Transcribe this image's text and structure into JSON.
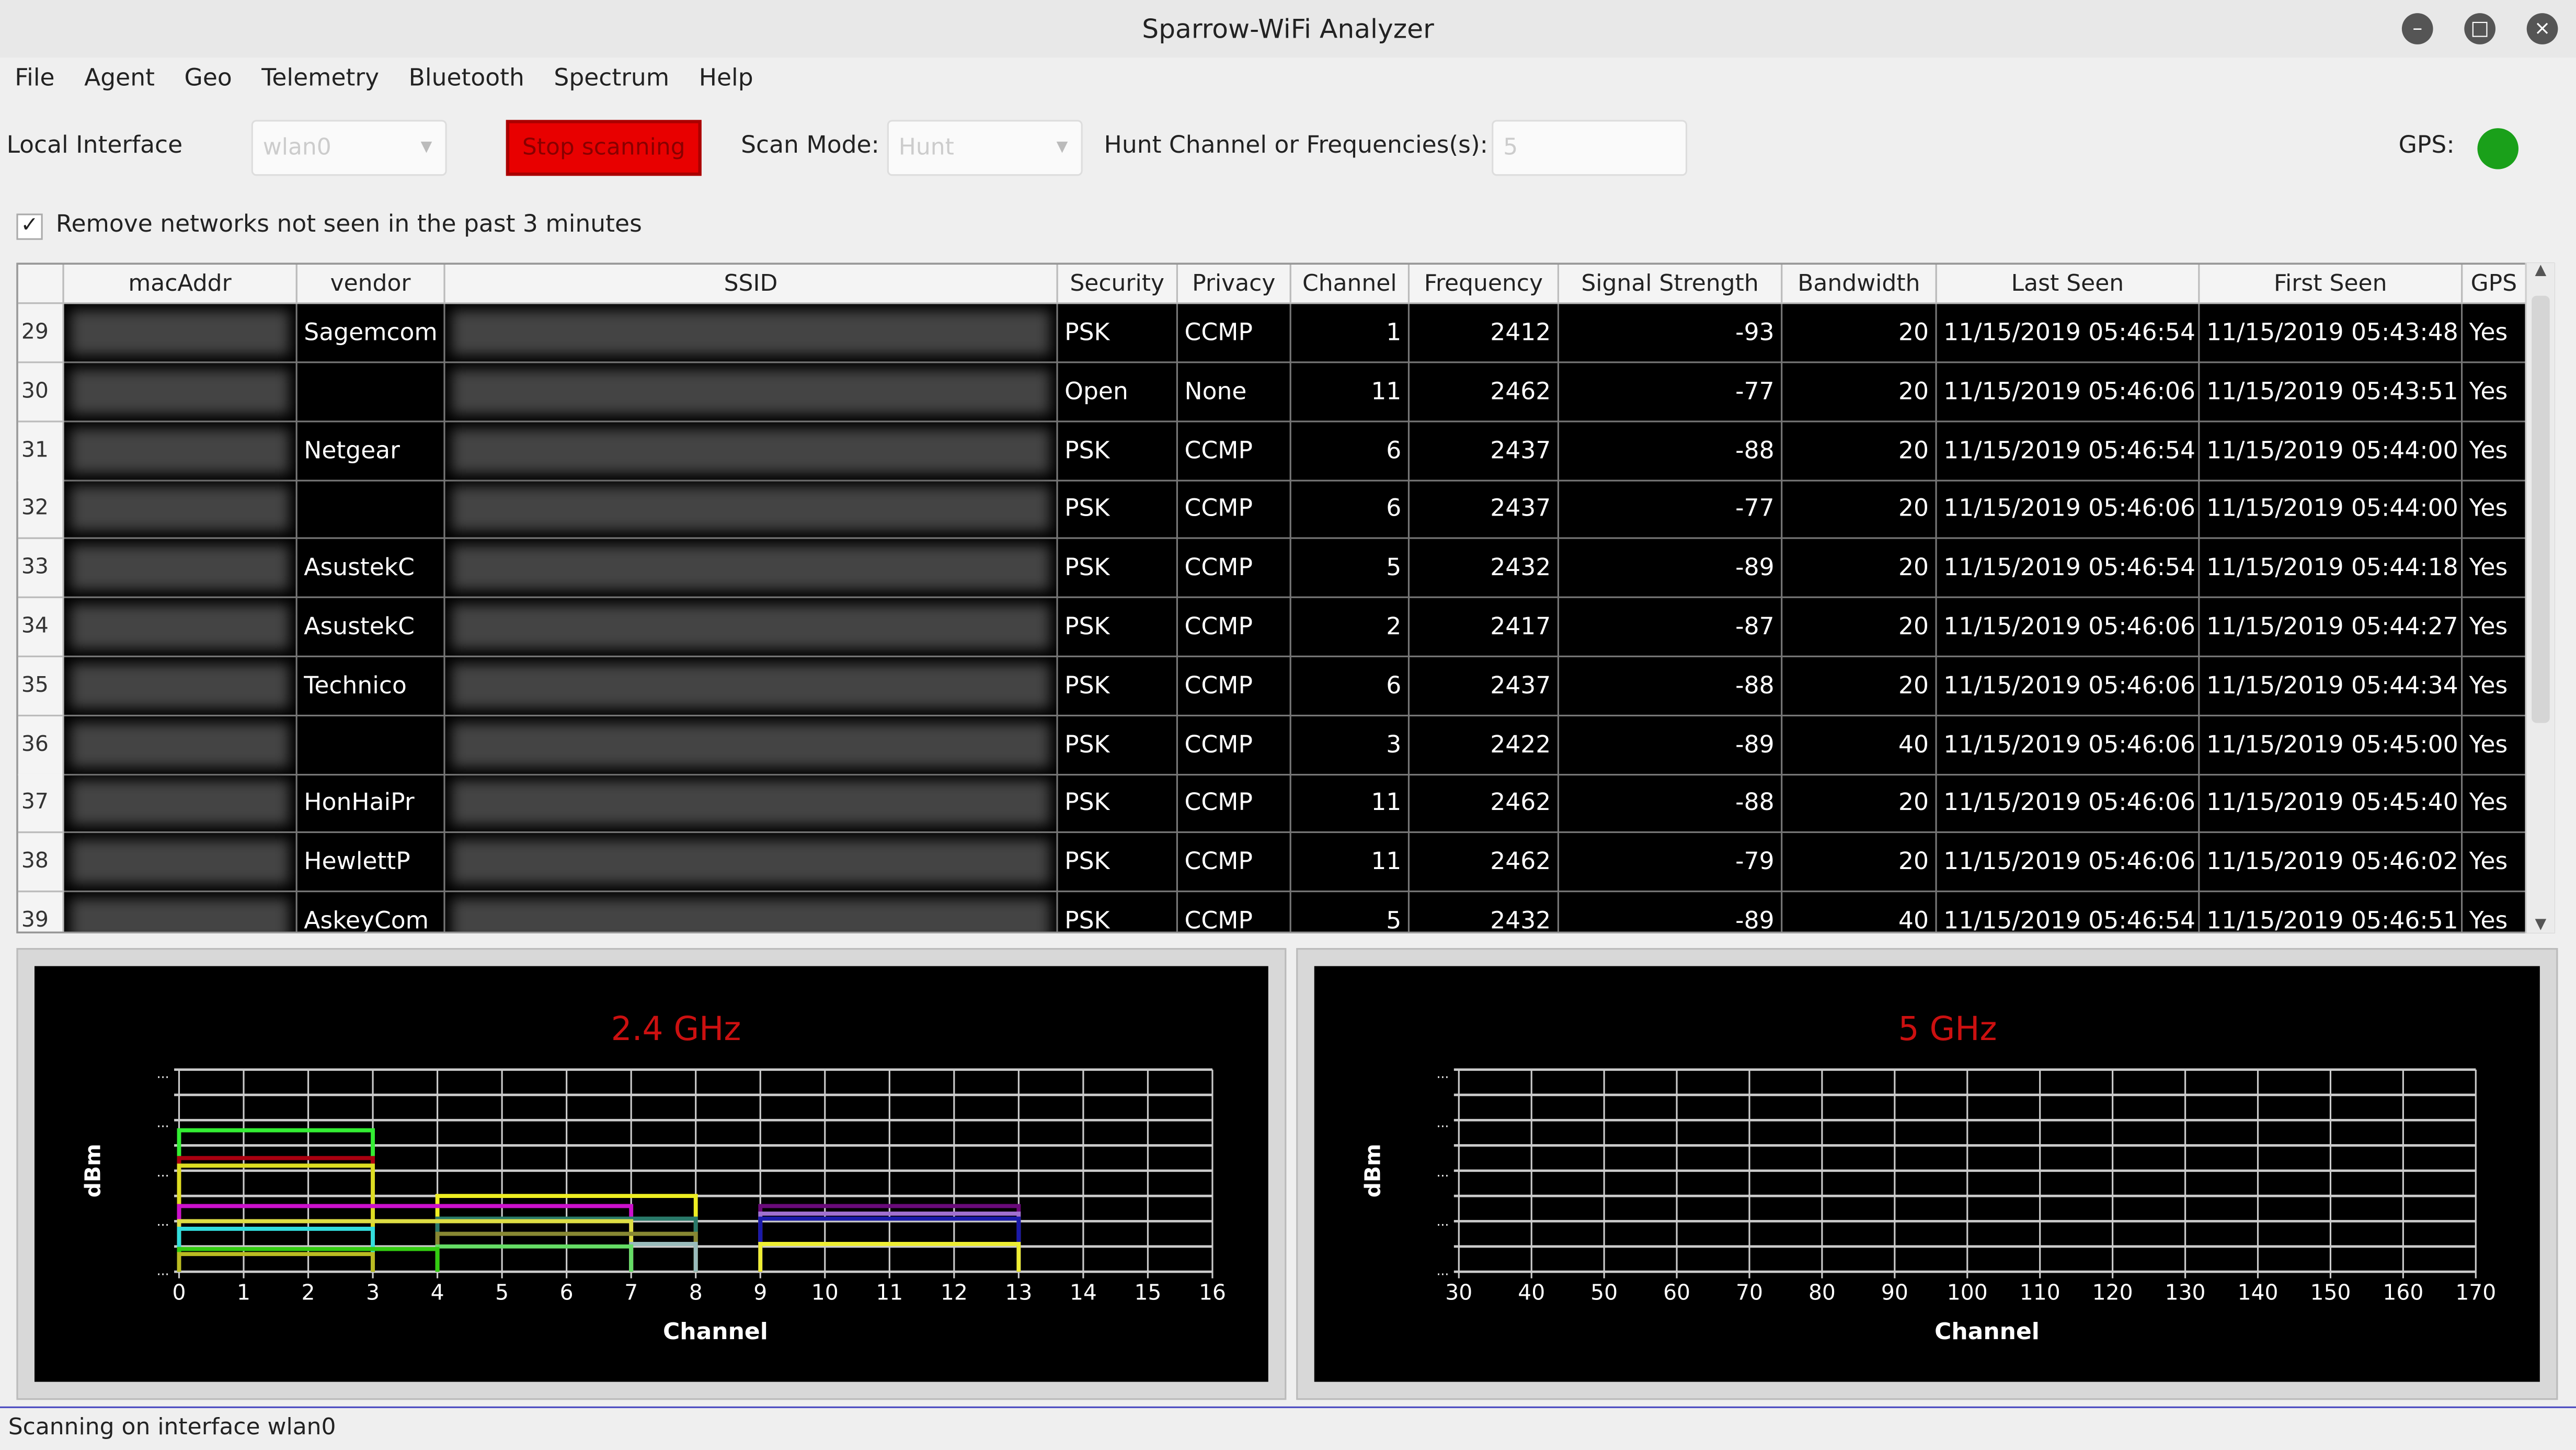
{
  "window": {
    "title": "Sparrow-WiFi Analyzer"
  },
  "menu": [
    "File",
    "Agent",
    "Geo",
    "Telemetry",
    "Bluetooth",
    "Spectrum",
    "Help"
  ],
  "toolbar": {
    "local_interface_label": "Local Interface",
    "interface_value": "wlan0",
    "stop_button": "Stop scanning",
    "scan_mode_label": "Scan Mode:",
    "scan_mode_value": "Hunt",
    "hunt_label": "Hunt Channel or Frequencies(s):",
    "hunt_value": "5",
    "gps_label": "GPS:",
    "gps_color": "#1aa01a"
  },
  "remove_old": {
    "checked": true,
    "label": "Remove networks not seen in the past 3 minutes"
  },
  "table": {
    "columns": [
      "macAddr",
      "vendor",
      "SSID",
      "Security",
      "Privacy",
      "Channel",
      "Frequency",
      "Signal Strength",
      "Bandwidth",
      "Last Seen",
      "First Seen",
      "GPS"
    ],
    "rows": [
      {
        "n": "29",
        "vendor": "Sagemcom",
        "security": "PSK",
        "privacy": "CCMP",
        "channel": "1",
        "frequency": "2412",
        "signal": "-93",
        "bandwidth": "20",
        "last": "11/15/2019 05:46:54",
        "first": "11/15/2019 05:43:48",
        "gps": "Yes"
      },
      {
        "n": "30",
        "vendor": "",
        "security": "Open",
        "privacy": "None",
        "channel": "11",
        "frequency": "2462",
        "signal": "-77",
        "bandwidth": "20",
        "last": "11/15/2019 05:46:06",
        "first": "11/15/2019 05:43:51",
        "gps": "Yes"
      },
      {
        "n": "31",
        "vendor": "Netgear",
        "security": "PSK",
        "privacy": "CCMP",
        "channel": "6",
        "frequency": "2437",
        "signal": "-88",
        "bandwidth": "20",
        "last": "11/15/2019 05:46:54",
        "first": "11/15/2019 05:44:00",
        "gps": "Yes"
      },
      {
        "n": "32",
        "vendor": "",
        "security": "PSK",
        "privacy": "CCMP",
        "channel": "6",
        "frequency": "2437",
        "signal": "-77",
        "bandwidth": "20",
        "last": "11/15/2019 05:46:06",
        "first": "11/15/2019 05:44:00",
        "gps": "Yes"
      },
      {
        "n": "33",
        "vendor": "AsustekC",
        "security": "PSK",
        "privacy": "CCMP",
        "channel": "5",
        "frequency": "2432",
        "signal": "-89",
        "bandwidth": "20",
        "last": "11/15/2019 05:46:54",
        "first": "11/15/2019 05:44:18",
        "gps": "Yes"
      },
      {
        "n": "34",
        "vendor": "AsustekC",
        "security": "PSK",
        "privacy": "CCMP",
        "channel": "2",
        "frequency": "2417",
        "signal": "-87",
        "bandwidth": "20",
        "last": "11/15/2019 05:46:06",
        "first": "11/15/2019 05:44:27",
        "gps": "Yes"
      },
      {
        "n": "35",
        "vendor": "Technico",
        "security": "PSK",
        "privacy": "CCMP",
        "channel": "6",
        "frequency": "2437",
        "signal": "-88",
        "bandwidth": "20",
        "last": "11/15/2019 05:46:06",
        "first": "11/15/2019 05:44:34",
        "gps": "Yes"
      },
      {
        "n": "36",
        "vendor": "",
        "security": "PSK",
        "privacy": "CCMP",
        "channel": "3",
        "frequency": "2422",
        "signal": "-89",
        "bandwidth": "40",
        "last": "11/15/2019 05:46:06",
        "first": "11/15/2019 05:45:00",
        "gps": "Yes"
      },
      {
        "n": "37",
        "vendor": "HonHaiPr",
        "security": "PSK",
        "privacy": "CCMP",
        "channel": "11",
        "frequency": "2462",
        "signal": "-88",
        "bandwidth": "20",
        "last": "11/15/2019 05:46:06",
        "first": "11/15/2019 05:45:40",
        "gps": "Yes"
      },
      {
        "n": "38",
        "vendor": "HewlettP",
        "security": "PSK",
        "privacy": "CCMP",
        "channel": "11",
        "frequency": "2462",
        "signal": "-79",
        "bandwidth": "20",
        "last": "11/15/2019 05:46:06",
        "first": "11/15/2019 05:46:02",
        "gps": "Yes"
      },
      {
        "n": "39",
        "vendor": "AskeyCom",
        "security": "PSK",
        "privacy": "CCMP",
        "channel": "5",
        "frequency": "2432",
        "signal": "-89",
        "bandwidth": "40",
        "last": "11/15/2019 05:46:54",
        "first": "11/15/2019 05:46:51",
        "gps": "Yes"
      }
    ]
  },
  "chart_data": [
    {
      "type": "line",
      "title": "2.4 GHz",
      "title_color": "#cc1010",
      "xlabel": "Channel",
      "ylabel": "dBm",
      "xlim": [
        0,
        16
      ],
      "xticks": [
        0,
        1,
        2,
        3,
        4,
        5,
        6,
        7,
        8,
        9,
        10,
        11,
        12,
        13,
        14,
        15,
        16
      ],
      "ylim": [
        -100,
        -20
      ],
      "y_tick_labels": "...",
      "grid": true,
      "series": [
        {
          "from": 0,
          "to": 3,
          "dbm": -44,
          "color": "#33ee33"
        },
        {
          "from": 0,
          "to": 3,
          "dbm": -55,
          "color": "#aa0010"
        },
        {
          "from": 0,
          "to": 3,
          "dbm": -58,
          "color": "#dddd22"
        },
        {
          "from": 4,
          "to": 8,
          "dbm": -70,
          "color": "#eeee22"
        },
        {
          "from": 0,
          "to": 7,
          "dbm": -74,
          "color": "#cc11cc"
        },
        {
          "from": 9,
          "to": 13,
          "dbm": -74,
          "color": "#6a0a7a"
        },
        {
          "from": 9,
          "to": 13,
          "dbm": -77,
          "color": "#a070d0"
        },
        {
          "from": 9,
          "to": 13,
          "dbm": -79,
          "color": "#1a1aaa"
        },
        {
          "from": 4,
          "to": 8,
          "dbm": -79,
          "color": "#2a7a6a"
        },
        {
          "from": 0,
          "to": 7,
          "dbm": -80,
          "color": "#dddd44"
        },
        {
          "from": 0,
          "to": 3,
          "dbm": -83,
          "color": "#33dddd"
        },
        {
          "from": 4,
          "to": 8,
          "dbm": -85,
          "color": "#888833"
        },
        {
          "from": 7,
          "to": 8,
          "dbm": -89,
          "color": "#99bbbb"
        },
        {
          "from": 4,
          "to": 7,
          "dbm": -90,
          "color": "#66dd66"
        },
        {
          "from": 9,
          "to": 13,
          "dbm": -89,
          "color": "#eeee33"
        },
        {
          "from": 0,
          "to": 4,
          "dbm": -91,
          "color": "#33cc11"
        },
        {
          "from": 0,
          "to": 3,
          "dbm": -93,
          "color": "#bbbb22"
        }
      ]
    },
    {
      "type": "line",
      "title": "5 GHz",
      "title_color": "#cc1010",
      "xlabel": "Channel",
      "ylabel": "dBm",
      "xlim": [
        30,
        170
      ],
      "xticks": [
        30,
        40,
        50,
        60,
        70,
        80,
        90,
        100,
        110,
        120,
        130,
        140,
        150,
        160,
        170
      ],
      "ylim": [
        -100,
        -20
      ],
      "y_tick_labels": "...",
      "grid": true,
      "series": []
    }
  ],
  "status": "Scanning on interface wlan0"
}
